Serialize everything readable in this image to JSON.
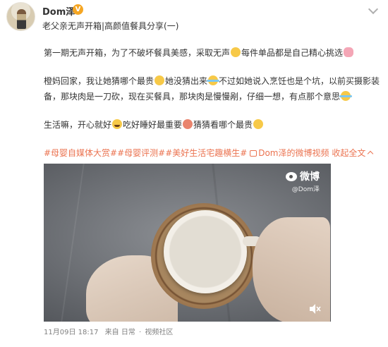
{
  "header": {
    "username": "Dom泽",
    "verified_badge": "V",
    "title": "老父亲无声开箱|高颜值餐具分享(一)"
  },
  "post": {
    "p1_a": "第一期无声开箱，为了不破坏餐具美感，采取无声",
    "p1_b": "每件单品都是自己精心挑选",
    "p2_a": "橙妈回家，我让她猜哪个最贵",
    "p2_b": "她没猜出来",
    "p2_c": "不过如她说入烹饪也是个坑，以前买摄影装备，那块肉是一刀砍，现在买餐具，那块肉是慢慢剐，仔细一想，有点那个意思",
    "p3_a": "生活嘛，开心就好",
    "p3_b": "吃好睡好最重要",
    "p3_c": "猜猜看哪个最贵"
  },
  "tags": {
    "t1": "#母婴自媒体大赏#",
    "t2": "#母婴评测#",
    "t3": "#美好生活宅趣横生#",
    "video_link": "Dom泽的微博视频",
    "expand": "收起全文",
    "expand_chevron": "^"
  },
  "video": {
    "watermark_brand": "微博",
    "watermark_handle": "@Dom泽",
    "icons": [
      "weibo-eye-icon",
      "mute-icon"
    ]
  },
  "meta": {
    "date": "11月09日 18:17",
    "source": "来自 日常",
    "channel": "视频社区",
    "separator": "·"
  },
  "colors": {
    "link": "#eb7350",
    "badge": "#f5a623",
    "meta": "#808080"
  }
}
